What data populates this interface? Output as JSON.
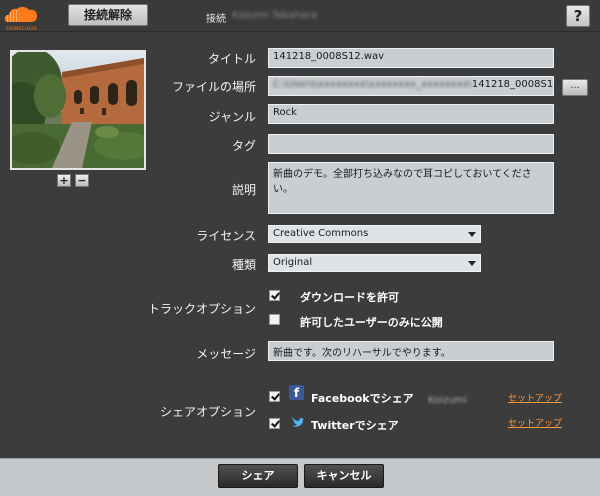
{
  "header": {
    "logo_text": "SOUNDCLOUD",
    "disconnect_label": "接続解除",
    "connection_label": "接続",
    "connected_user": "Kazumi Takahara",
    "help_label": "?"
  },
  "artwork": {
    "zoom_in_label": "+",
    "zoom_out_label": "−"
  },
  "form": {
    "title": {
      "label": "タイトル",
      "value": "141218_0008S12.wav"
    },
    "file_location": {
      "label": "ファイルの場所",
      "value_hidden": "C:\\Users\\xxxxxxxx\\xxxxxxxx_xxxxxxxx\\",
      "value": "141218_0008S12.wav",
      "browse_label": "..."
    },
    "genre": {
      "label": "ジャンル",
      "value": "Rock"
    },
    "tags": {
      "label": "タグ",
      "value": ""
    },
    "description": {
      "label": "説明",
      "value": "新曲のデモ。全部打ち込みなので耳コピしておいてください。"
    },
    "license": {
      "label": "ライセンス",
      "value": "Creative Commons"
    },
    "type": {
      "label": "種類",
      "value": "Original"
    },
    "track_options": {
      "label": "トラックオプション",
      "allow_download": {
        "label": "ダウンロードを許可",
        "checked": true
      },
      "private_only": {
        "label": "許可したユーザーのみに公開",
        "checked": false
      }
    },
    "message": {
      "label": "メッセージ",
      "value": "新曲です。次のリハーサルでやります。"
    },
    "share_options": {
      "label": "シェアオプション",
      "facebook": {
        "label": "Facebookでシェア",
        "checked": true,
        "account": "Koizumi",
        "setup_label": "セットアップ"
      },
      "twitter": {
        "label": "Twitterでシェア",
        "checked": true,
        "setup_label": "セットアップ"
      }
    }
  },
  "footer": {
    "share_label": "シェア",
    "cancel_label": "キャンセル"
  },
  "colors": {
    "background": "#3c3c3c",
    "field": "#c9ced2",
    "link": "#ff9a3a",
    "facebook": "#3b5998",
    "twitter": "#4fb6f0",
    "brand": "#ff7a1a"
  }
}
